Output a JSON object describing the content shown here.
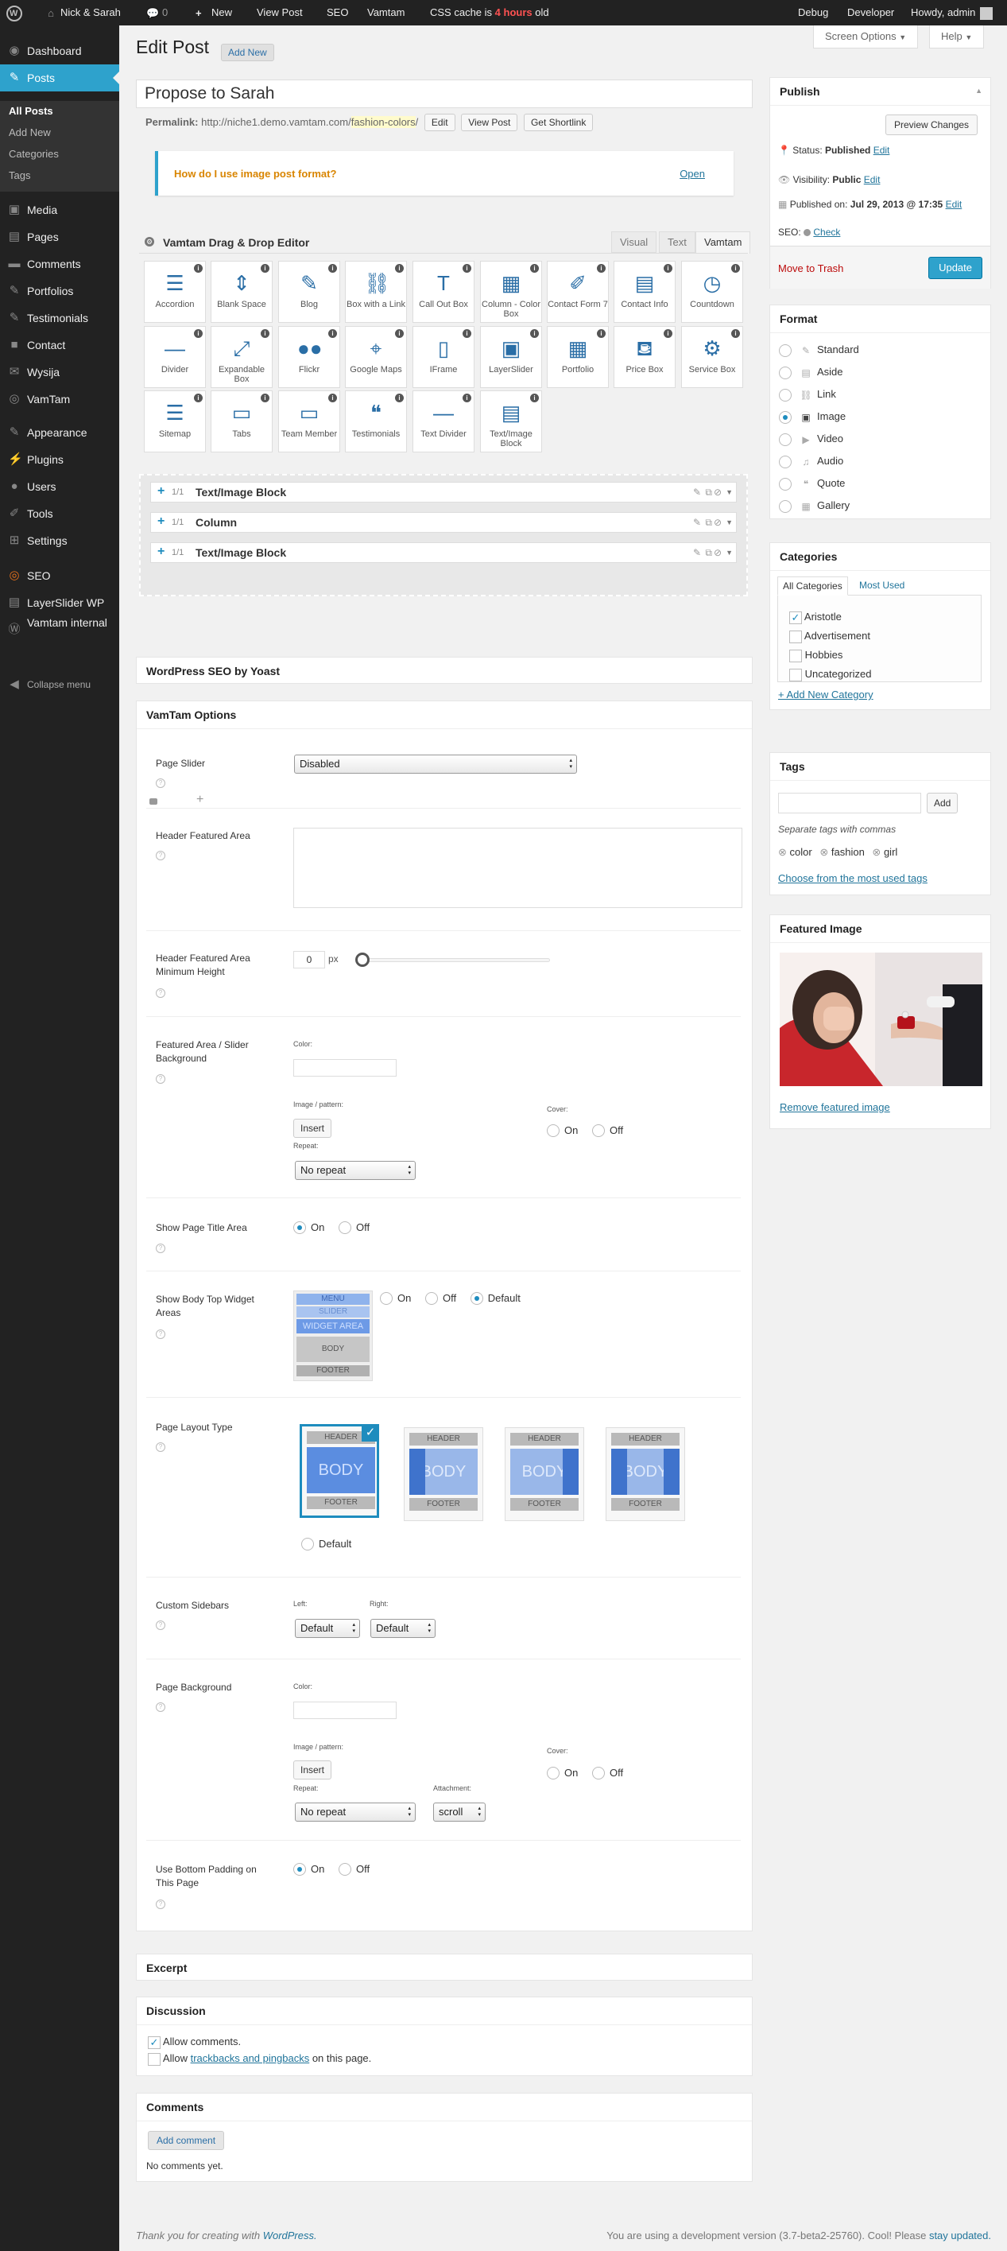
{
  "adminbar": {
    "site_name": "Nick & Sarah",
    "comments_count": "0",
    "new_label": "New",
    "view_post": "View Post",
    "seo": "SEO",
    "vamtam": "Vamtam",
    "css_cache_prefix": "CSS cache is",
    "css_cache_age": "4 hours",
    "css_cache_suffix": "old",
    "debug": "Debug",
    "developer": "Developer",
    "howdy": "Howdy, admin"
  },
  "sidebar": {
    "items": [
      {
        "label": "Dashboard",
        "icon": "dashboard-icon"
      },
      {
        "label": "Posts",
        "icon": "pin-icon"
      },
      {
        "label": "Media",
        "icon": "media-icon"
      },
      {
        "label": "Pages",
        "icon": "pages-icon"
      },
      {
        "label": "Comments",
        "icon": "comments-icon"
      },
      {
        "label": "Portfolios",
        "icon": "pin-icon"
      },
      {
        "label": "Testimonials",
        "icon": "pin-icon"
      },
      {
        "label": "Contact",
        "icon": "contact-icon"
      },
      {
        "label": "Wysija",
        "icon": "wysija-icon"
      },
      {
        "label": "VamTam",
        "icon": "vamtam-icon"
      },
      {
        "label": "Appearance",
        "icon": "appearance-icon"
      },
      {
        "label": "Plugins",
        "icon": "plugins-icon"
      },
      {
        "label": "Users",
        "icon": "users-icon"
      },
      {
        "label": "Tools",
        "icon": "tools-icon"
      },
      {
        "label": "Settings",
        "icon": "settings-icon"
      },
      {
        "label": "SEO",
        "icon": "seo-icon"
      },
      {
        "label": "LayerSlider WP",
        "icon": "layerslider-icon"
      },
      {
        "label": "Vamtam internal",
        "icon": "wp-icon"
      },
      {
        "label": "Collapse menu",
        "icon": "collapse-icon"
      }
    ],
    "submenu": [
      "All Posts",
      "Add New",
      "Categories",
      "Tags"
    ]
  },
  "header": {
    "screen_options": "Screen Options",
    "help": "Help",
    "page_title": "Edit Post",
    "add_new": "Add New"
  },
  "post": {
    "title": "Propose to Sarah",
    "permalink_label": "Permalink:",
    "permalink_base": "http://niche1.demo.vamtam.com/",
    "permalink_slug": "fashion-colors",
    "permalink_end": "/",
    "edit_btn": "Edit",
    "view_btn": "View Post",
    "shortlink_btn": "Get Shortlink"
  },
  "notice": {
    "question": "How do I use image post format?",
    "open": "Open"
  },
  "editor": {
    "title": "Vamtam Drag & Drop Editor",
    "tabs": [
      "Visual",
      "Text",
      "Vamtam"
    ],
    "tools": [
      {
        "label": "Accordion",
        "icon": "accordion-icon",
        "glyph": "☰"
      },
      {
        "label": "Blank Space",
        "icon": "blank-space-icon",
        "glyph": "⇕"
      },
      {
        "label": "Blog",
        "icon": "blog-icon",
        "glyph": "✎"
      },
      {
        "label": "Box with a Link",
        "icon": "link-icon",
        "glyph": "⛓"
      },
      {
        "label": "Call Out Box",
        "icon": "callout-icon",
        "glyph": "T"
      },
      {
        "label": "Column - Color Box",
        "icon": "column-icon",
        "glyph": "▦"
      },
      {
        "label": "Contact Form 7",
        "icon": "contact-form-icon",
        "glyph": "✐"
      },
      {
        "label": "Contact Info",
        "icon": "contact-info-icon",
        "glyph": "▤"
      },
      {
        "label": "Countdown",
        "icon": "countdown-icon",
        "glyph": "◷"
      },
      {
        "label": "Divider",
        "icon": "divider-icon",
        "glyph": "—"
      },
      {
        "label": "Expandable Box",
        "icon": "expand-icon",
        "glyph": "⤢"
      },
      {
        "label": "Flickr",
        "icon": "flickr-icon",
        "glyph": "●●"
      },
      {
        "label": "Google Maps",
        "icon": "map-pin-icon",
        "glyph": "⌖"
      },
      {
        "label": "IFrame",
        "icon": "iframe-icon",
        "glyph": "▯"
      },
      {
        "label": "LayerSlider",
        "icon": "image-icon",
        "glyph": "▣"
      },
      {
        "label": "Portfolio",
        "icon": "portfolio-icon",
        "glyph": "▦"
      },
      {
        "label": "Price Box",
        "icon": "basket-icon",
        "glyph": "⛾"
      },
      {
        "label": "Service Box",
        "icon": "gear-icon",
        "glyph": "⚙"
      },
      {
        "label": "Sitemap",
        "icon": "sitemap-icon",
        "glyph": "☰"
      },
      {
        "label": "Tabs",
        "icon": "tabs-icon",
        "glyph": "▭"
      },
      {
        "label": "Team Member",
        "icon": "team-icon",
        "glyph": "▭"
      },
      {
        "label": "Testimonials",
        "icon": "quote-icon",
        "glyph": "❝"
      },
      {
        "label": "Text Divider",
        "icon": "text-divider-icon",
        "glyph": "—"
      },
      {
        "label": "Text/Image Block",
        "icon": "document-icon",
        "glyph": "▤"
      }
    ],
    "elements": [
      {
        "size": "1/1",
        "name": "Text/Image Block"
      },
      {
        "size": "1/1",
        "name": "Column"
      },
      {
        "size": "1/1",
        "name": "Text/Image Block"
      }
    ]
  },
  "seo_box_title": "WordPress SEO by Yoast",
  "options": {
    "title": "VamTam Options",
    "page_slider_label": "Page Slider",
    "page_slider_value": "Disabled",
    "header_featured_label": "Header Featured Area",
    "header_min_height_label": "Header Featured Area Minimum Height",
    "header_min_height_value": "0",
    "px": "px",
    "featured_bg_label": "Featured Area / Slider Background",
    "color": "Color:",
    "image_pattern": "Image / pattern:",
    "insert": "Insert",
    "repeat": "Repeat:",
    "no_repeat": "No repeat",
    "cover": "Cover:",
    "on": "On",
    "off": "Off",
    "default": "Default",
    "show_title_label": "Show Page Title Area",
    "body_top_label": "Show Body Top Widget Areas",
    "widget_preview": [
      "MENU",
      "SLIDER",
      "WIDGET AREA",
      "BODY",
      "FOOTER"
    ],
    "layout_label": "Page Layout Type",
    "layout_header": "HEADER",
    "layout_body": "BODY",
    "layout_footer": "FOOTER",
    "custom_sidebars_label": "Custom Sidebars",
    "left": "Left:",
    "right": "Right:",
    "page_bg_label": "Page Background",
    "attachment": "Attachment:",
    "scroll": "scroll",
    "bottom_padding_label": "Use Bottom Padding on This Page"
  },
  "excerpt_title": "Excerpt",
  "discussion": {
    "title": "Discussion",
    "allow_comments": "Allow comments.",
    "allow_prefix": "Allow",
    "trackbacks": "trackbacks and pingbacks",
    "allow_suffix": "on this page."
  },
  "comments": {
    "title": "Comments",
    "add": "Add comment",
    "none": "No comments yet."
  },
  "publish": {
    "title": "Publish",
    "preview": "Preview Changes",
    "status_label": "Status:",
    "status_value": "Published",
    "visibility_label": "Visibility:",
    "visibility_value": "Public",
    "published_label": "Published on:",
    "published_value": "Jul 29, 2013 @ 17:35",
    "edit": "Edit",
    "seo_label": "SEO:",
    "check": "Check",
    "trash": "Move to Trash",
    "update": "Update"
  },
  "format": {
    "title": "Format",
    "options": [
      {
        "label": "Standard",
        "icon": "pin-icon",
        "glyph": "✎"
      },
      {
        "label": "Aside",
        "icon": "aside-icon",
        "glyph": "▤"
      },
      {
        "label": "Link",
        "icon": "link-icon",
        "glyph": "⛓"
      },
      {
        "label": "Image",
        "icon": "image-icon",
        "glyph": "▣"
      },
      {
        "label": "Video",
        "icon": "video-icon",
        "glyph": "▶"
      },
      {
        "label": "Audio",
        "icon": "audio-icon",
        "glyph": "♫"
      },
      {
        "label": "Quote",
        "icon": "quote-icon",
        "glyph": "❝"
      },
      {
        "label": "Gallery",
        "icon": "gallery-icon",
        "glyph": "▦"
      }
    ],
    "selected": "Image"
  },
  "categories": {
    "title": "Categories",
    "tab_all": "All Categories",
    "tab_used": "Most Used",
    "items": [
      {
        "label": "Aristotle",
        "checked": true
      },
      {
        "label": "Advertisement",
        "checked": false
      },
      {
        "label": "Hobbies",
        "checked": false
      },
      {
        "label": "Uncategorized",
        "checked": false
      }
    ],
    "add_new": "+ Add New Category"
  },
  "tags": {
    "title": "Tags",
    "add": "Add",
    "hint": "Separate tags with commas",
    "items": [
      "color",
      "fashion",
      "girl"
    ],
    "choose": "Choose from the most used tags"
  },
  "featured_image": {
    "title": "Featured Image",
    "remove": "Remove featured image"
  },
  "footer": {
    "thanks_prefix": "Thank you for creating with",
    "wordpress": "WordPress.",
    "version": "You are using a development version (3.7-beta2-25760). Cool! Please",
    "stay": "stay updated."
  },
  "colors": {
    "accent": "#2ea2cc",
    "admin_bar": "#222222",
    "link": "#21759b",
    "trash": "#bc0b0b",
    "update": "#2ea2cc"
  }
}
